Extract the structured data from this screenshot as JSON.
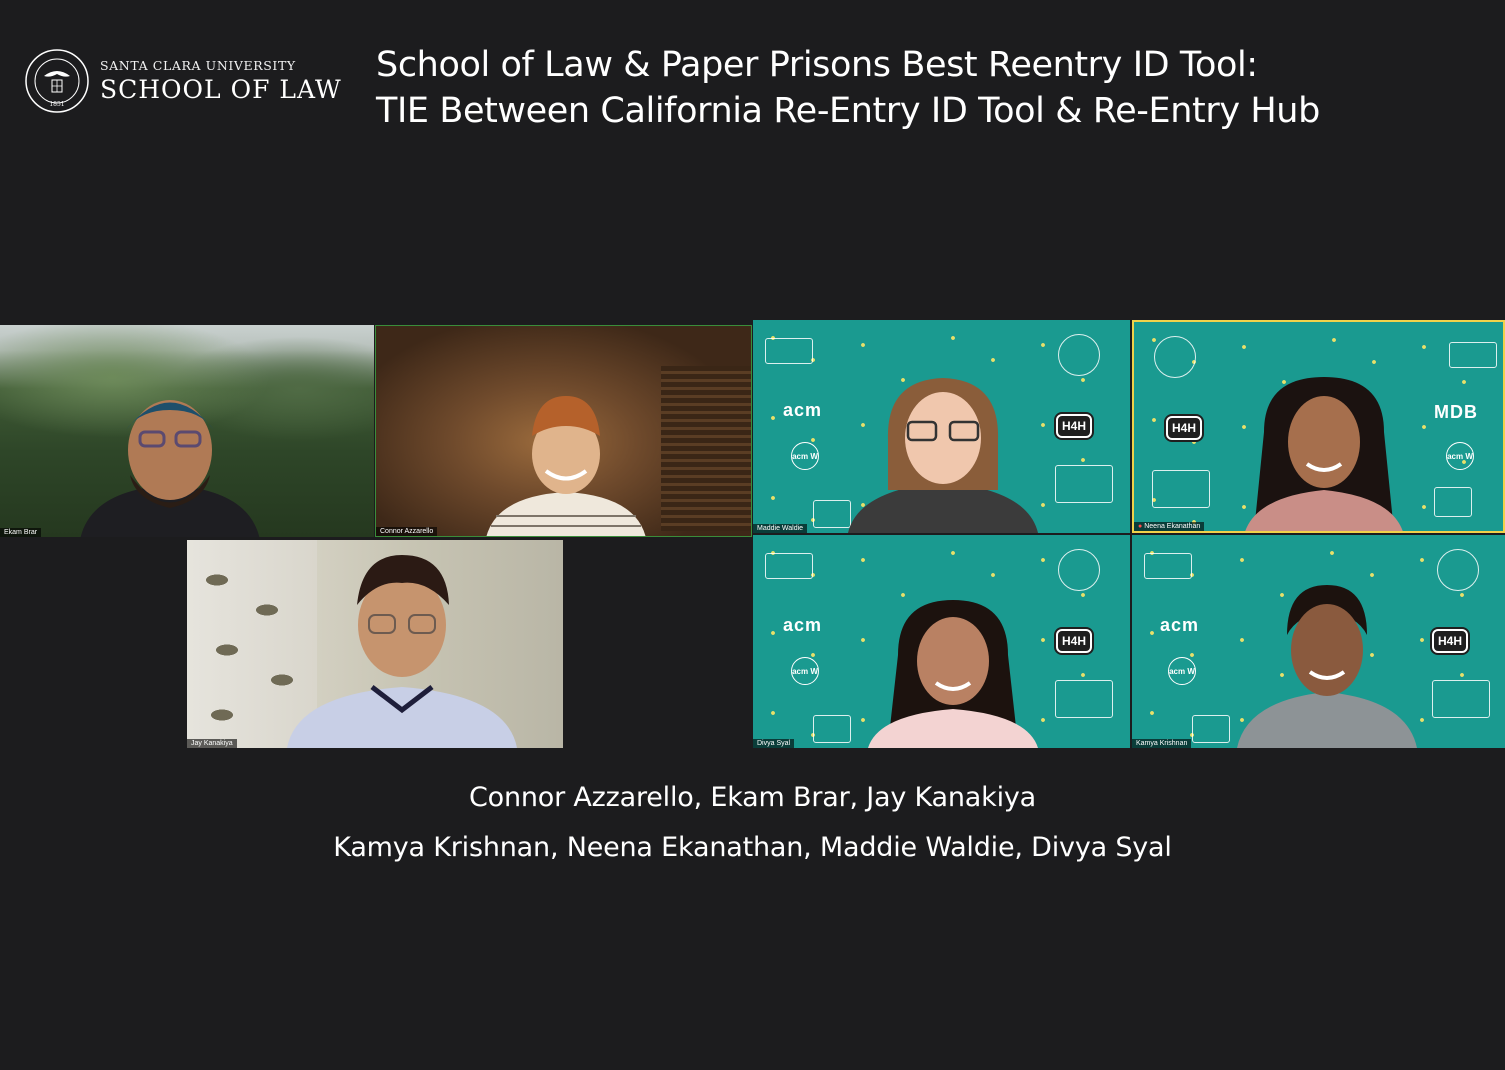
{
  "logo": {
    "university": "SANTA CLARA UNIVERSITY",
    "school": "SCHOOL OF LAW"
  },
  "headline": {
    "line1": "School of Law & Paper Prisons Best Reentry ID Tool:",
    "line2": "TIE Between California Re-Entry ID Tool & Re-Entry Hub"
  },
  "tiles": [
    {
      "id": "ekam",
      "name": "Ekam Brar"
    },
    {
      "id": "connor",
      "name": "Connor Azzarello"
    },
    {
      "id": "jay",
      "name": "Jay Kanakiya"
    },
    {
      "id": "maddie",
      "name": "Maddie Waldie"
    },
    {
      "id": "neena",
      "name": "Neena Ekanathan"
    },
    {
      "id": "divya",
      "name": "Divya Syal"
    },
    {
      "id": "kamya",
      "name": "Kamya Krishnan"
    }
  ],
  "backgrounds": {
    "acm_label": "acm",
    "acmw_label": "acm W",
    "h4h_label": "H4H",
    "mdb_label": "MDB"
  },
  "names": {
    "line1": "Connor Azzarello, Ekam Brar, Jay Kanakiya",
    "line2": "Kamya Krishnan, Neena Ekanathan, Maddie Waldie, Divya Syal"
  },
  "colors": {
    "page_bg": "#1c1c1e",
    "teal": "#1a9a90",
    "active_speaker": "#f0d24a"
  }
}
